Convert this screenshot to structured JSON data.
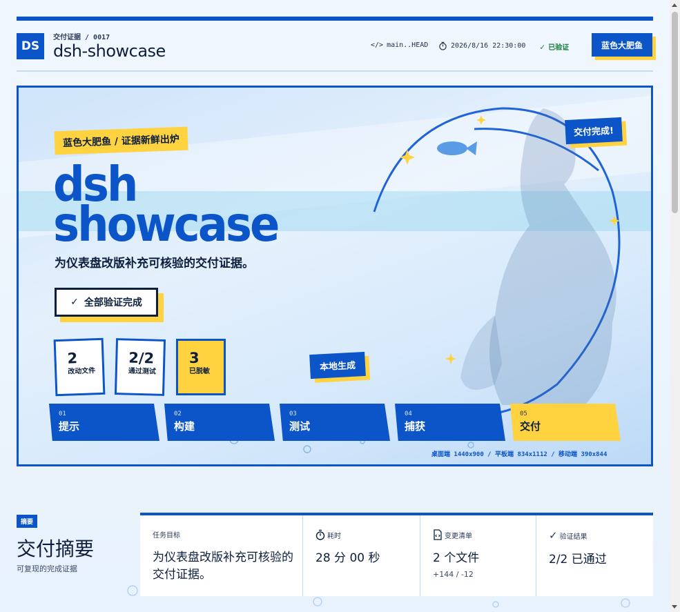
{
  "header": {
    "logo": "DS",
    "breadcrumb": "交付证据 / 0017",
    "title": "dsh-showcase",
    "branch": "main..HEAD",
    "datetime": "2026/8/16 22:30:00",
    "verified": "已验证",
    "brand_button": "蓝色大肥鱼"
  },
  "hero": {
    "tag": "蓝色大肥鱼 / 证据新鲜出炉",
    "title_line1": "dsh",
    "title_line2": "showcase",
    "subtitle": "为仪表盘改版补充可核验的交付证据。",
    "status": "全部验证完成",
    "stats": [
      {
        "value": "2",
        "label": "改动文件"
      },
      {
        "value": "2/2",
        "label": "通过测试"
      },
      {
        "value": "3",
        "label": "已脱敏"
      }
    ],
    "local_badge": "本地生成",
    "done_badge": "交付完成!",
    "steps": [
      {
        "num": "01",
        "label": "提示"
      },
      {
        "num": "02",
        "label": "构建"
      },
      {
        "num": "03",
        "label": "测试"
      },
      {
        "num": "04",
        "label": "捕获"
      },
      {
        "num": "05",
        "label": "交付"
      }
    ],
    "viewports": "桌面端 1440x900 / 平板端 834x1112 / 移动端 390x844"
  },
  "summary": {
    "label": "摘要",
    "title": "交付摘要",
    "subtitle": "可复现的完成证据",
    "cells": [
      {
        "heading": "任务目标",
        "value": "为仪表盘改版补充可核验的交付证据。",
        "sub": ""
      },
      {
        "heading": "耗时",
        "value": "28 分 00 秒",
        "sub": ""
      },
      {
        "heading": "变更清单",
        "value": "2 个文件",
        "sub": "+144 / -12"
      },
      {
        "heading": "验证结果",
        "value": "2/2 已通过",
        "sub": ""
      }
    ]
  },
  "colors": {
    "primary": "#0b55c9",
    "accent": "#ffd23f",
    "success": "#16803c"
  }
}
